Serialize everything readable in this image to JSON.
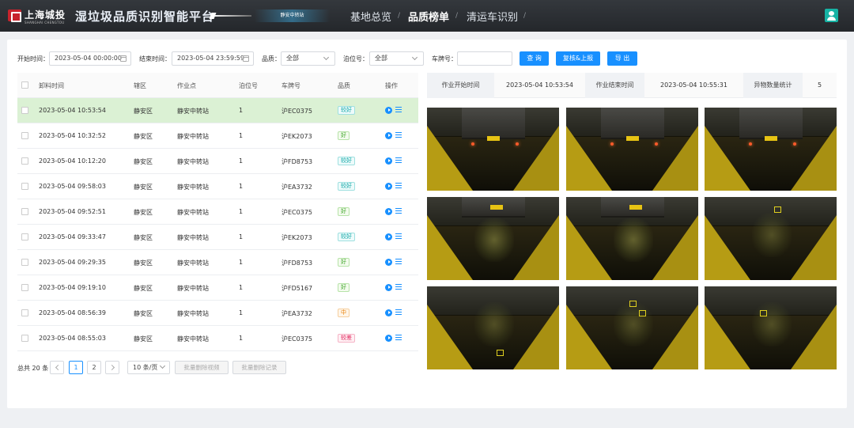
{
  "header": {
    "logo_text": "上海城投",
    "logo_sub": "SHANGHAI CHENGTOU",
    "app_title": "湿垃圾品质识别智能平台",
    "site_badge": "静安中转站",
    "nav": [
      {
        "label": "基地总览",
        "active": false
      },
      {
        "label": "品质榜单",
        "active": true
      },
      {
        "label": "清运车识别",
        "active": false
      }
    ]
  },
  "filters": {
    "start_label": "开始时间：",
    "start_value": "2023-05-04 00:00:00",
    "end_label": "结束时间：",
    "end_value": "2023-05-04 23:59:59",
    "quality_label": "品质：",
    "quality_value": "全部",
    "berth_label": "泊位号：",
    "berth_value": "全部",
    "plate_label": "车牌号：",
    "plate_value": "",
    "query_label": "查 询",
    "review_label": "复核&上报",
    "export_label": "导 出"
  },
  "table": {
    "columns": [
      "卸料时间",
      "辖区",
      "作业点",
      "泊位号",
      "车牌号",
      "品质",
      "操作"
    ],
    "rows": [
      {
        "time": "2023-05-04 10:53:54",
        "district": "静安区",
        "site": "静安中转站",
        "berth": "1",
        "plate": "沪EC0375",
        "quality": "较好",
        "level": "good",
        "selected": true
      },
      {
        "time": "2023-05-04 10:32:52",
        "district": "静安区",
        "site": "静安中转站",
        "berth": "1",
        "plate": "沪EK2073",
        "quality": "好",
        "level": "ok",
        "selected": false
      },
      {
        "time": "2023-05-04 10:12:20",
        "district": "静安区",
        "site": "静安中转站",
        "berth": "1",
        "plate": "沪FD8753",
        "quality": "较好",
        "level": "good",
        "selected": false
      },
      {
        "time": "2023-05-04 09:58:03",
        "district": "静安区",
        "site": "静安中转站",
        "berth": "1",
        "plate": "沪EA3732",
        "quality": "较好",
        "level": "good",
        "selected": false
      },
      {
        "time": "2023-05-04 09:52:51",
        "district": "静安区",
        "site": "静安中转站",
        "berth": "1",
        "plate": "沪EC0375",
        "quality": "好",
        "level": "ok",
        "selected": false
      },
      {
        "time": "2023-05-04 09:33:47",
        "district": "静安区",
        "site": "静安中转站",
        "berth": "1",
        "plate": "沪EK2073",
        "quality": "较好",
        "level": "good",
        "selected": false
      },
      {
        "time": "2023-05-04 09:29:35",
        "district": "静安区",
        "site": "静安中转站",
        "berth": "1",
        "plate": "沪FD8753",
        "quality": "好",
        "level": "ok",
        "selected": false
      },
      {
        "time": "2023-05-04 09:19:10",
        "district": "静安区",
        "site": "静安中转站",
        "berth": "1",
        "plate": "沪FD5167",
        "quality": "好",
        "level": "ok",
        "selected": false
      },
      {
        "time": "2023-05-04 08:56:39",
        "district": "静安区",
        "site": "静安中转站",
        "berth": "1",
        "plate": "沪EA3732",
        "quality": "中",
        "level": "mid",
        "selected": false
      },
      {
        "time": "2023-05-04 08:55:03",
        "district": "静安区",
        "site": "静安中转站",
        "berth": "1",
        "plate": "沪EC0375",
        "quality": "较差",
        "level": "bad",
        "selected": false
      }
    ]
  },
  "pagination": {
    "total": "总共 20 条",
    "pages": [
      "1",
      "2"
    ],
    "current": "1",
    "page_size": "10 条/页",
    "delete_video": "批量删除视频",
    "delete_record": "批量删除记录"
  },
  "info": {
    "start_key": "作业开始时间",
    "start_value": "2023-05-04 10:53:54",
    "end_key": "作业结束时间",
    "end_value": "2023-05-04 10:55:31",
    "count_key": "异物数量统计",
    "count_value": "5"
  },
  "colors": {
    "accent": "#1890ff",
    "selected_row": "#dbf1d4",
    "header_bg": "#2b2e32",
    "user_icon": "#17b3a5"
  }
}
